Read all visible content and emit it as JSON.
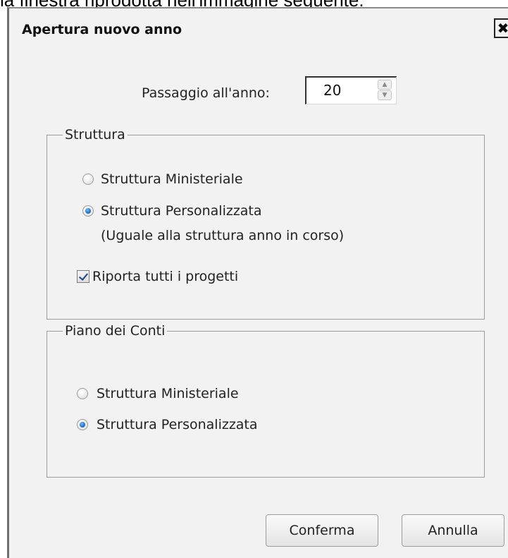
{
  "caption": "la finestra riprodotta nell'immagine seguente:",
  "dialog": {
    "title": "Apertura nuovo anno",
    "close_glyph": "✖"
  },
  "year": {
    "label": "Passaggio all'anno:",
    "value": "20",
    "spin_up_glyph": "▲",
    "spin_down_glyph": "▼"
  },
  "struttura": {
    "legend": "Struttura",
    "option_ministeriale": "Struttura Ministeriale",
    "option_personalizzata": "Struttura Personalizzata",
    "option_personalizzata_note": "(Uguale alla struttura anno in corso)",
    "selected": "personalizzata",
    "checkbox_label": "Riporta tutti i progetti",
    "checkbox_checked": true
  },
  "piano_conti": {
    "legend": "Piano dei Conti",
    "option_ministeriale": "Struttura Ministeriale",
    "option_personalizzata": "Struttura Personalizzata",
    "selected": "personalizzata"
  },
  "buttons": {
    "confirm": "Conferma",
    "cancel": "Annulla"
  },
  "colors": {
    "dialog_bg": "#f2f2f2",
    "radio_selected": "#1b6fd2"
  }
}
